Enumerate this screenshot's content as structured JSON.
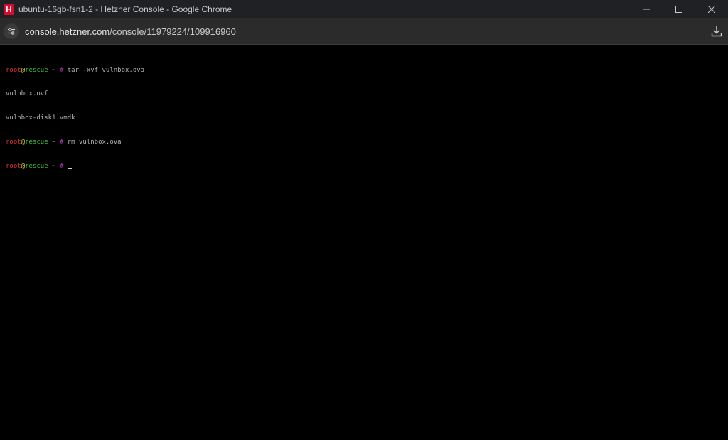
{
  "window": {
    "title": "ubuntu-16gb-fsn1-2 - Hetzner Console - Google Chrome",
    "app_icon_letter": "H",
    "icon_color": "#d50c2d"
  },
  "address_bar": {
    "host": "console.hetzner.com",
    "path": "/console/11979224/109916960"
  },
  "terminal": {
    "prompt": {
      "user": "root",
      "at": "@",
      "host": "rescue",
      "dir": " ~ ",
      "symbol": "#"
    },
    "lines": [
      {
        "type": "command",
        "text": " tar -xvf vulnbox.ova"
      },
      {
        "type": "output",
        "text": "vulnbox.ovf"
      },
      {
        "type": "output",
        "text": "vulnbox-disk1.vmdk"
      },
      {
        "type": "command",
        "text": " rm vulnbox.ova"
      },
      {
        "type": "command",
        "text": " "
      }
    ],
    "colors": {
      "user": "#e03030",
      "at": "#d0d020",
      "host": "#40c040",
      "prompt": "#c040c0",
      "text": "#b0b0b0"
    }
  }
}
